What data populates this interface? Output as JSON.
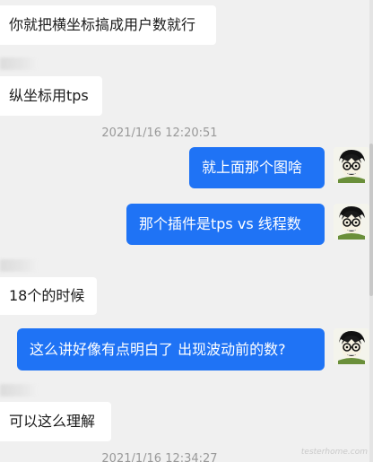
{
  "messages": [
    {
      "text": "你就把横坐标搞成用户数就行"
    },
    {
      "text": "纵坐标用tps"
    },
    {
      "text": "就上面那个图啥"
    },
    {
      "text": "那个插件是tps vs 线程数"
    },
    {
      "text": "18个的时候"
    },
    {
      "text": "这么讲好像有点明白了 出现波动前的数?"
    },
    {
      "text": "可以这么理解"
    }
  ],
  "timestamps": [
    "2021/1/16 12:20:51",
    "2021/1/16 12:34:27"
  ],
  "watermark": "testerhome.com",
  "colors": {
    "outgoing_bubble": "#1f73f5",
    "incoming_bubble": "#ffffff",
    "background": "#f0f0f0",
    "timestamp_text": "#999999"
  }
}
